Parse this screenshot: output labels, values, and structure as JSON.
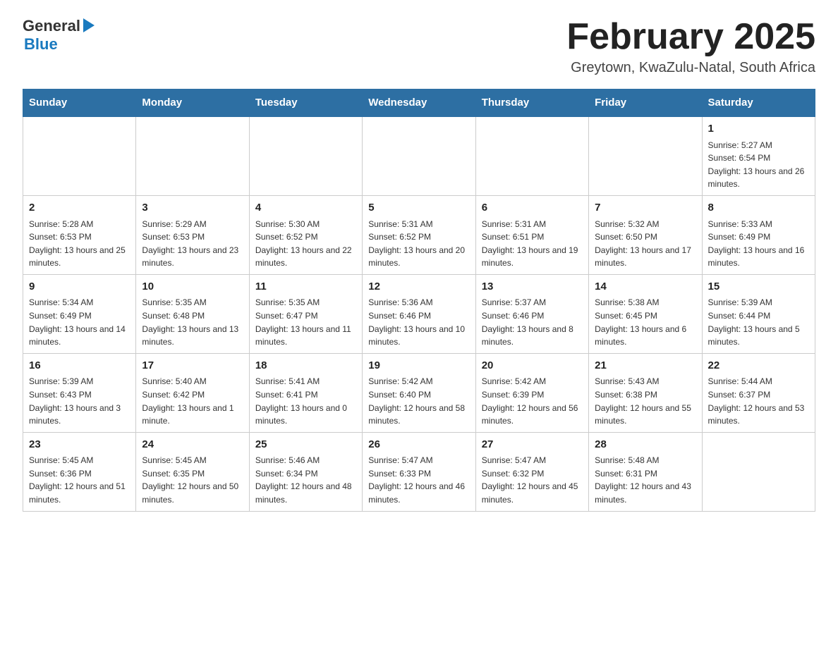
{
  "header": {
    "logo": {
      "general": "General",
      "blue": "Blue"
    },
    "title": "February 2025",
    "subtitle": "Greytown, KwaZulu-Natal, South Africa"
  },
  "calendar": {
    "days_of_week": [
      "Sunday",
      "Monday",
      "Tuesday",
      "Wednesday",
      "Thursday",
      "Friday",
      "Saturday"
    ],
    "weeks": [
      [
        {
          "day": "",
          "info": ""
        },
        {
          "day": "",
          "info": ""
        },
        {
          "day": "",
          "info": ""
        },
        {
          "day": "",
          "info": ""
        },
        {
          "day": "",
          "info": ""
        },
        {
          "day": "",
          "info": ""
        },
        {
          "day": "1",
          "info": "Sunrise: 5:27 AM\nSunset: 6:54 PM\nDaylight: 13 hours and 26 minutes."
        }
      ],
      [
        {
          "day": "2",
          "info": "Sunrise: 5:28 AM\nSunset: 6:53 PM\nDaylight: 13 hours and 25 minutes."
        },
        {
          "day": "3",
          "info": "Sunrise: 5:29 AM\nSunset: 6:53 PM\nDaylight: 13 hours and 23 minutes."
        },
        {
          "day": "4",
          "info": "Sunrise: 5:30 AM\nSunset: 6:52 PM\nDaylight: 13 hours and 22 minutes."
        },
        {
          "day": "5",
          "info": "Sunrise: 5:31 AM\nSunset: 6:52 PM\nDaylight: 13 hours and 20 minutes."
        },
        {
          "day": "6",
          "info": "Sunrise: 5:31 AM\nSunset: 6:51 PM\nDaylight: 13 hours and 19 minutes."
        },
        {
          "day": "7",
          "info": "Sunrise: 5:32 AM\nSunset: 6:50 PM\nDaylight: 13 hours and 17 minutes."
        },
        {
          "day": "8",
          "info": "Sunrise: 5:33 AM\nSunset: 6:49 PM\nDaylight: 13 hours and 16 minutes."
        }
      ],
      [
        {
          "day": "9",
          "info": "Sunrise: 5:34 AM\nSunset: 6:49 PM\nDaylight: 13 hours and 14 minutes."
        },
        {
          "day": "10",
          "info": "Sunrise: 5:35 AM\nSunset: 6:48 PM\nDaylight: 13 hours and 13 minutes."
        },
        {
          "day": "11",
          "info": "Sunrise: 5:35 AM\nSunset: 6:47 PM\nDaylight: 13 hours and 11 minutes."
        },
        {
          "day": "12",
          "info": "Sunrise: 5:36 AM\nSunset: 6:46 PM\nDaylight: 13 hours and 10 minutes."
        },
        {
          "day": "13",
          "info": "Sunrise: 5:37 AM\nSunset: 6:46 PM\nDaylight: 13 hours and 8 minutes."
        },
        {
          "day": "14",
          "info": "Sunrise: 5:38 AM\nSunset: 6:45 PM\nDaylight: 13 hours and 6 minutes."
        },
        {
          "day": "15",
          "info": "Sunrise: 5:39 AM\nSunset: 6:44 PM\nDaylight: 13 hours and 5 minutes."
        }
      ],
      [
        {
          "day": "16",
          "info": "Sunrise: 5:39 AM\nSunset: 6:43 PM\nDaylight: 13 hours and 3 minutes."
        },
        {
          "day": "17",
          "info": "Sunrise: 5:40 AM\nSunset: 6:42 PM\nDaylight: 13 hours and 1 minute."
        },
        {
          "day": "18",
          "info": "Sunrise: 5:41 AM\nSunset: 6:41 PM\nDaylight: 13 hours and 0 minutes."
        },
        {
          "day": "19",
          "info": "Sunrise: 5:42 AM\nSunset: 6:40 PM\nDaylight: 12 hours and 58 minutes."
        },
        {
          "day": "20",
          "info": "Sunrise: 5:42 AM\nSunset: 6:39 PM\nDaylight: 12 hours and 56 minutes."
        },
        {
          "day": "21",
          "info": "Sunrise: 5:43 AM\nSunset: 6:38 PM\nDaylight: 12 hours and 55 minutes."
        },
        {
          "day": "22",
          "info": "Sunrise: 5:44 AM\nSunset: 6:37 PM\nDaylight: 12 hours and 53 minutes."
        }
      ],
      [
        {
          "day": "23",
          "info": "Sunrise: 5:45 AM\nSunset: 6:36 PM\nDaylight: 12 hours and 51 minutes."
        },
        {
          "day": "24",
          "info": "Sunrise: 5:45 AM\nSunset: 6:35 PM\nDaylight: 12 hours and 50 minutes."
        },
        {
          "day": "25",
          "info": "Sunrise: 5:46 AM\nSunset: 6:34 PM\nDaylight: 12 hours and 48 minutes."
        },
        {
          "day": "26",
          "info": "Sunrise: 5:47 AM\nSunset: 6:33 PM\nDaylight: 12 hours and 46 minutes."
        },
        {
          "day": "27",
          "info": "Sunrise: 5:47 AM\nSunset: 6:32 PM\nDaylight: 12 hours and 45 minutes."
        },
        {
          "day": "28",
          "info": "Sunrise: 5:48 AM\nSunset: 6:31 PM\nDaylight: 12 hours and 43 minutes."
        },
        {
          "day": "",
          "info": ""
        }
      ]
    ]
  }
}
